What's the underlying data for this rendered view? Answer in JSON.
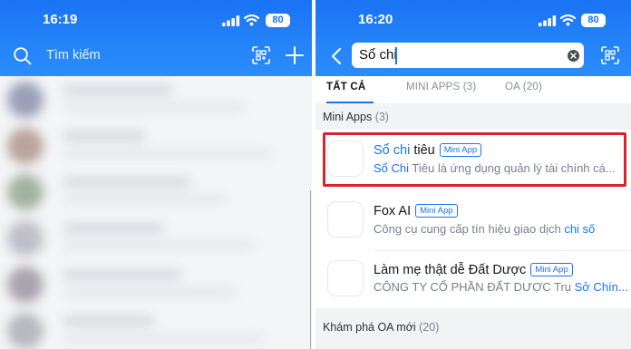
{
  "left": {
    "status": {
      "time": "16:19",
      "battery": "80"
    },
    "header": {
      "search_label": "Tìm kiếm"
    }
  },
  "right": {
    "status": {
      "time": "16:20",
      "battery": "80"
    },
    "search": {
      "value": "Sổ chi"
    },
    "tabs": [
      {
        "label": "TẤT CẢ",
        "active": true
      },
      {
        "label": "MINI APPS (3)",
        "active": false
      },
      {
        "label": "OA (20)",
        "active": false
      }
    ],
    "mini_apps_section": {
      "title": "Mini Apps",
      "count": "(3)"
    },
    "results": [
      {
        "title_hl": "Sổ chi",
        "title_rest": " tiêu",
        "badge": "Mini App",
        "desc_hl": "Sổ Chi",
        "desc_rest": " Tiêu là ứng dụng quản lý tài chính cá..."
      },
      {
        "title_hl": "",
        "title_rest": "Fox AI",
        "badge": "Mini App",
        "desc_pre": "Công cụ cung cấp tín hiệu giao dịch ",
        "desc_hl": "chi số"
      },
      {
        "title_hl": "",
        "title_rest": "Làm mẹ thật dễ Đất Dược",
        "badge": "Mini App",
        "desc_pre": "CÔNG TY CỔ PHẦN ĐẤT DƯỢC Trụ ",
        "desc_hl": "Sở Chín..."
      }
    ],
    "oa_section": {
      "title": "Khám phá OA mới",
      "count": "(20)"
    }
  },
  "colors": {
    "accent": "#1a72f3",
    "highlight_border": "#d7232d"
  },
  "icons": [
    "search-icon",
    "qr-scan-icon",
    "plus-icon",
    "back-icon",
    "clear-icon",
    "signal-icon",
    "wifi-icon",
    "battery-icon"
  ]
}
